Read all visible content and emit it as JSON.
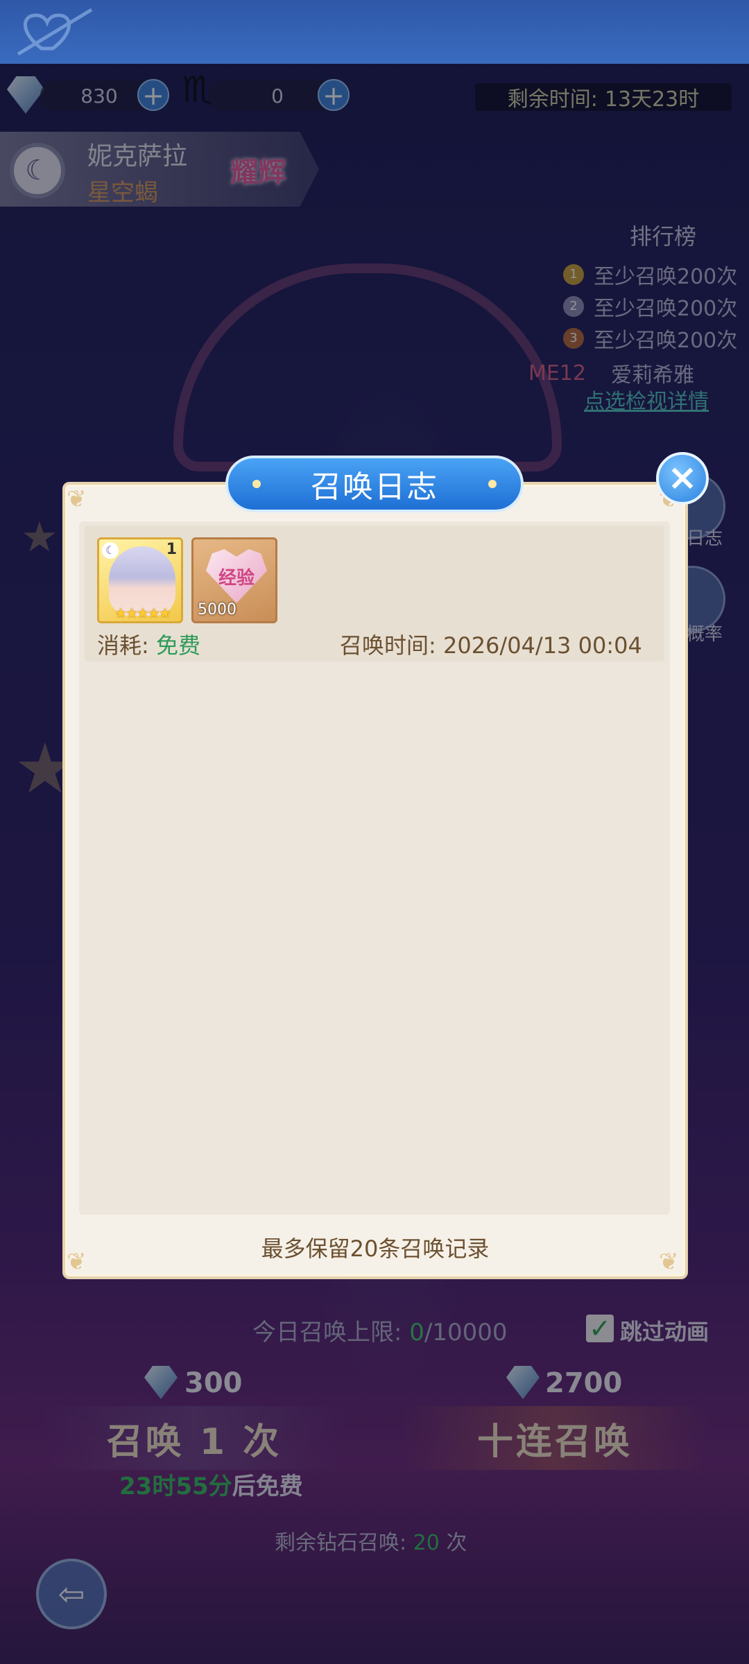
{
  "resources": {
    "diamonds": "830",
    "secondary": "0",
    "remaining_time_label": "剩余时间:",
    "remaining_time_value": "13天23时"
  },
  "character": {
    "name": "妮克萨拉",
    "title": "星空蝎",
    "badge": "耀辉"
  },
  "ranking": {
    "title": "排行榜",
    "rows": [
      {
        "medal": "1",
        "text": "至少召唤200次",
        "color": "#c9a23a"
      },
      {
        "medal": "2",
        "text": "至少召唤200次",
        "color": "#8f8fb8"
      },
      {
        "medal": "3",
        "text": "至少召唤200次",
        "color": "#b56a3a"
      }
    ],
    "player_tag": "ME12",
    "player_name": "爱莉希雅",
    "detail_link": "点选检视详情"
  },
  "side": {
    "log_label": "日志",
    "rate_label": "概率"
  },
  "modal": {
    "title": "召唤日志",
    "record": {
      "char_count": "1",
      "char_stars": "★★★★★",
      "exp_label": "经验",
      "exp_count": "5000",
      "consume_label": "消耗:",
      "consume_value": "免费",
      "time_label": "召唤时间:",
      "time_value": "2026/04/13 00:04"
    },
    "footer": "最多保留20条召唤记录"
  },
  "bottom": {
    "limit_label": "今日召唤上限:",
    "limit_current": "0",
    "limit_total": "/10000",
    "skip_label": "跳过动画",
    "single_cost": "300",
    "ten_cost": "2700",
    "single_label": "召唤 1 次",
    "ten_label": "十连召唤",
    "free_time": "23时55分",
    "free_suffix": "后免费",
    "remain_label": "剩余钻石召唤:",
    "remain_count": "20",
    "remain_unit": "次"
  }
}
